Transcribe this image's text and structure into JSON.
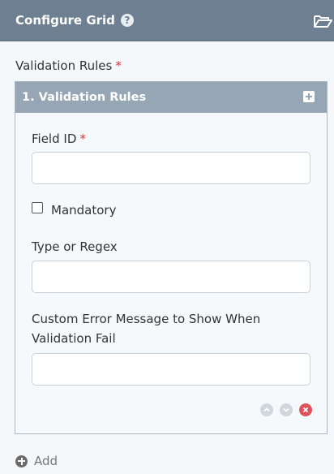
{
  "header": {
    "title": "Configure Grid",
    "help_icon": "question-circle-icon",
    "open_icon": "folder-open-icon",
    "color": "#6d7f90"
  },
  "section": {
    "label": "Validation Rules",
    "required_mark": "*"
  },
  "panel": {
    "title": "1. Validation Rules",
    "expand_icon": "plus-square-icon",
    "header_color": "#96a6b5",
    "fields": {
      "field_id": {
        "label": "Field ID",
        "required_mark": "*",
        "value": ""
      },
      "mandatory": {
        "label": "Mandatory",
        "checked": false
      },
      "type_or_regex": {
        "label": "Type or Regex",
        "value": ""
      },
      "custom_error": {
        "label_line1": "Custom Error Message to Show When",
        "label_line2": "Validation Fail",
        "value": ""
      }
    },
    "controls": [
      "move-up-icon",
      "move-down-icon",
      "remove-icon"
    ]
  },
  "add": {
    "label": "Add",
    "icon": "plus-circle-icon"
  },
  "colors": {
    "required": "#d9363e",
    "remove": "#e0525a"
  }
}
